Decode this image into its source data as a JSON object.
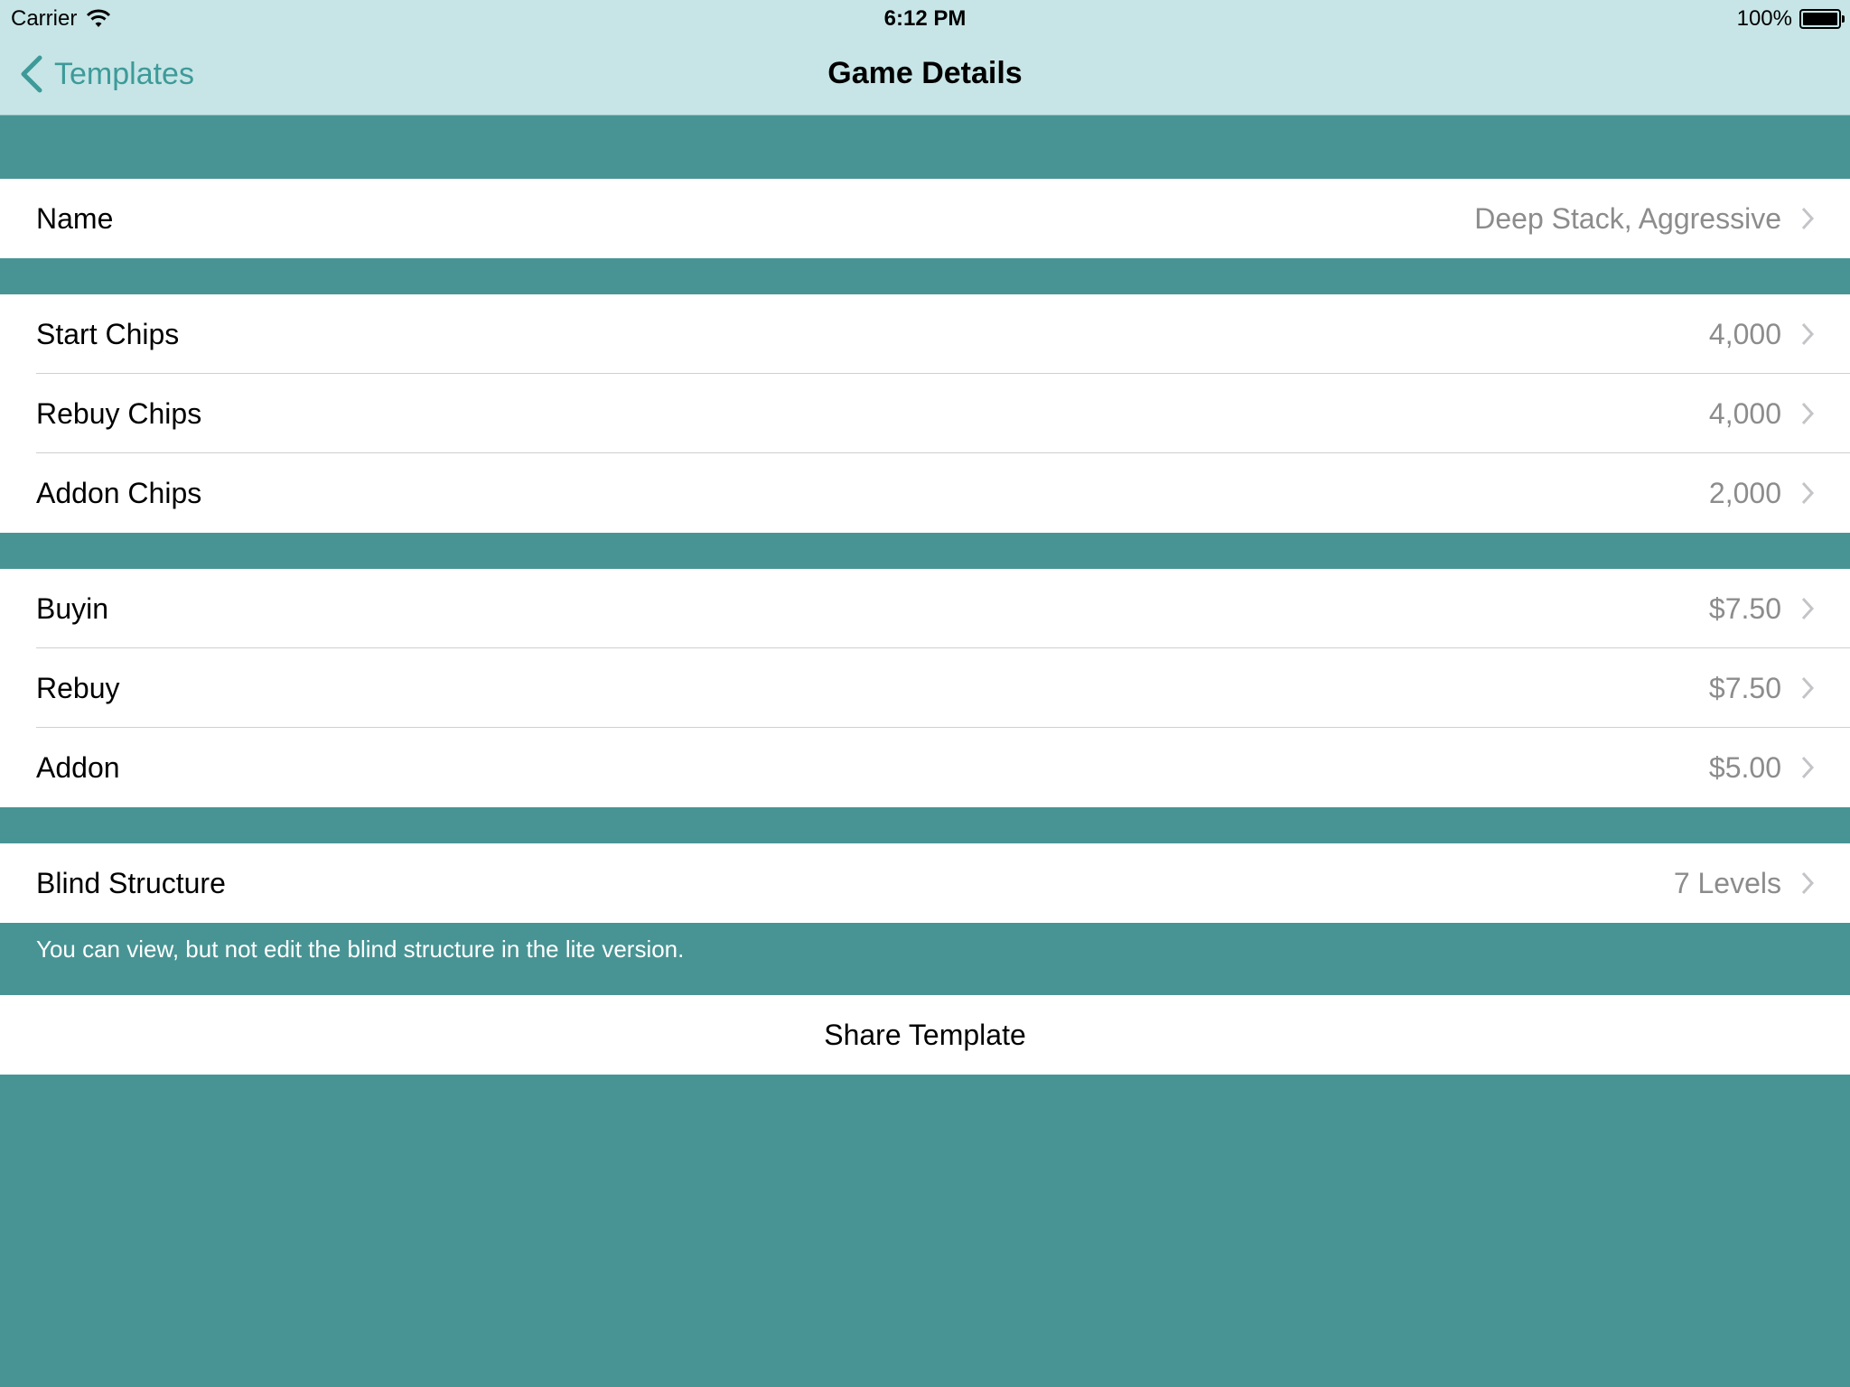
{
  "status_bar": {
    "carrier": "Carrier",
    "time": "6:12 PM",
    "battery": "100%"
  },
  "nav": {
    "back_label": "Templates",
    "title": "Game Details"
  },
  "sections": [
    {
      "rows": [
        {
          "label": "Name",
          "value": "Deep Stack, Aggressive"
        }
      ]
    },
    {
      "rows": [
        {
          "label": "Start Chips",
          "value": "4,000"
        },
        {
          "label": "Rebuy Chips",
          "value": "4,000"
        },
        {
          "label": "Addon Chips",
          "value": "2,000"
        }
      ]
    },
    {
      "rows": [
        {
          "label": "Buyin",
          "value": "$7.50"
        },
        {
          "label": "Rebuy",
          "value": "$7.50"
        },
        {
          "label": "Addon",
          "value": "$5.00"
        }
      ]
    },
    {
      "rows": [
        {
          "label": "Blind Structure",
          "value": "7 Levels"
        }
      ],
      "footer": "You can view, but not edit the blind structure in the lite version."
    }
  ],
  "share_label": "Share Template",
  "colors": {
    "background": "#489494",
    "navbar": "#c7e5e6",
    "accent": "#3d9a99",
    "value_text": "#8c8c8c"
  }
}
